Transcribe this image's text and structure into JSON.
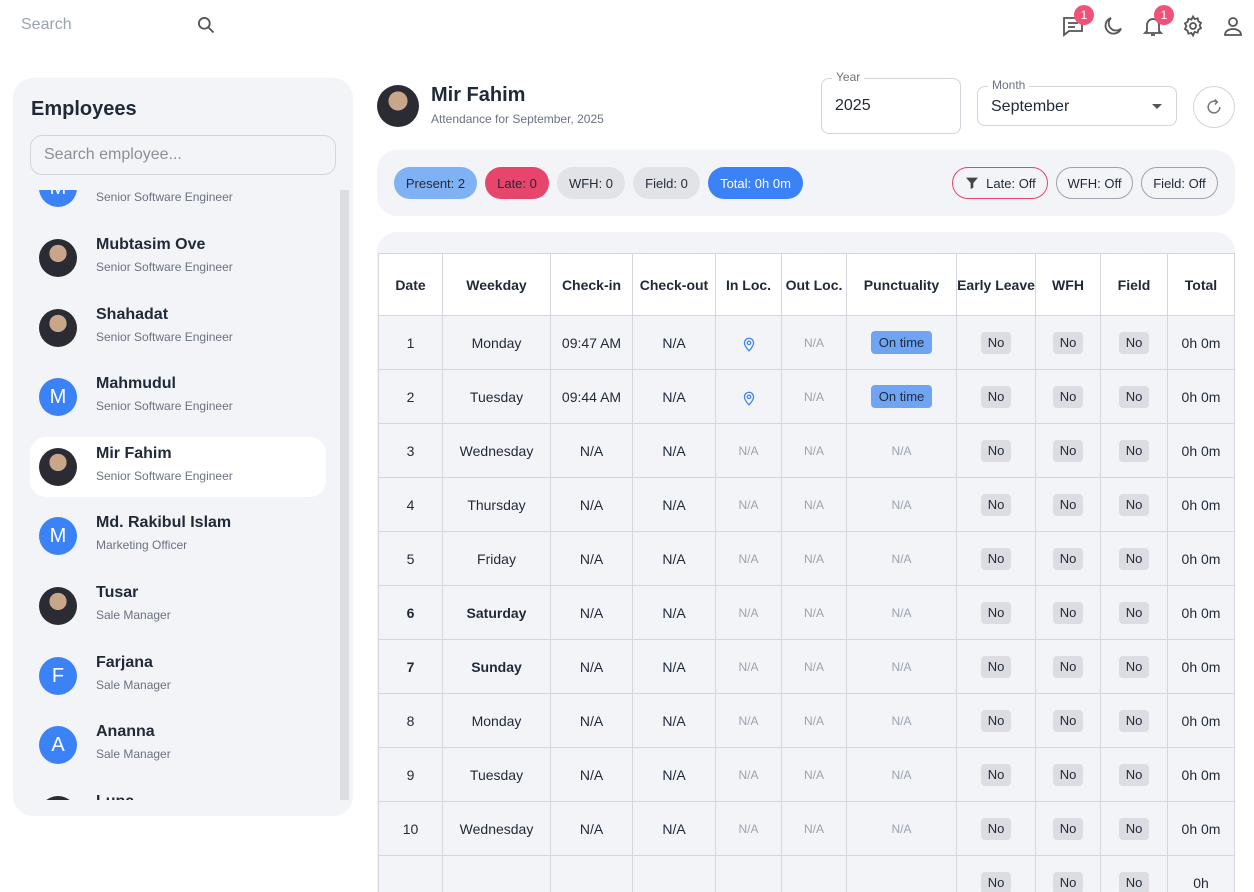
{
  "topbar": {
    "search_placeholder": "Search",
    "messages_badge": "1",
    "notifications_badge": "1"
  },
  "sidebar": {
    "title": "Employees",
    "search_placeholder": "Search employee...",
    "employees": [
      {
        "name": "",
        "role": "Senior Software Engineer",
        "avatar": "M",
        "avatar_type": "letter"
      },
      {
        "name": "Mubtasim Ove",
        "role": "Senior Software Engineer",
        "avatar": "",
        "avatar_type": "photo"
      },
      {
        "name": "Shahadat",
        "role": "Senior Software Engineer",
        "avatar": "",
        "avatar_type": "photo"
      },
      {
        "name": "Mahmudul",
        "role": "Senior Software Engineer",
        "avatar": "M",
        "avatar_type": "letter"
      },
      {
        "name": "Mir Fahim",
        "role": "Senior Software Engineer",
        "avatar": "",
        "avatar_type": "photo",
        "selected": true
      },
      {
        "name": "Md. Rakibul Islam",
        "role": "Marketing Officer",
        "avatar": "M",
        "avatar_type": "letter"
      },
      {
        "name": "Tusar",
        "role": "Sale Manager",
        "avatar": "",
        "avatar_type": "photo"
      },
      {
        "name": "Farjana",
        "role": "Sale Manager",
        "avatar": "F",
        "avatar_type": "letter"
      },
      {
        "name": "Ananna",
        "role": "Sale Manager",
        "avatar": "A",
        "avatar_type": "letter"
      },
      {
        "name": "Lupa",
        "role": "",
        "avatar": "",
        "avatar_type": "photo"
      }
    ]
  },
  "header": {
    "name": "Mir Fahim",
    "subtitle": "Attendance for September, 2025",
    "year_label": "Year",
    "year_value": "2025",
    "month_label": "Month",
    "month_value": "September"
  },
  "summary": {
    "present": "Present: 2",
    "late": "Late: 0",
    "wfh": "WFH: 0",
    "field": "Field: 0",
    "total": "Total: 0h 0m",
    "filter_late": "Late: Off",
    "filter_wfh": "WFH: Off",
    "filter_field": "Field: Off"
  },
  "table": {
    "columns": [
      "Date",
      "Weekday",
      "Check-in",
      "Check-out",
      "In Loc.",
      "Out Loc.",
      "Punctuality",
      "Early Leave",
      "WFH",
      "Field",
      "Total"
    ],
    "rows": [
      {
        "date": "1",
        "weekday": "Monday",
        "checkin": "09:47 AM",
        "checkout": "N/A",
        "inloc": "pin",
        "outloc": "N/A",
        "punctuality": "On time",
        "early": "No",
        "wfh": "No",
        "field": "No",
        "total": "0h 0m",
        "weekend": false
      },
      {
        "date": "2",
        "weekday": "Tuesday",
        "checkin": "09:44 AM",
        "checkout": "N/A",
        "inloc": "pin",
        "outloc": "N/A",
        "punctuality": "On time",
        "early": "No",
        "wfh": "No",
        "field": "No",
        "total": "0h 0m",
        "weekend": false
      },
      {
        "date": "3",
        "weekday": "Wednesday",
        "checkin": "N/A",
        "checkout": "N/A",
        "inloc": "N/A",
        "outloc": "N/A",
        "punctuality": "N/A",
        "early": "No",
        "wfh": "No",
        "field": "No",
        "total": "0h 0m",
        "weekend": false
      },
      {
        "date": "4",
        "weekday": "Thursday",
        "checkin": "N/A",
        "checkout": "N/A",
        "inloc": "N/A",
        "outloc": "N/A",
        "punctuality": "N/A",
        "early": "No",
        "wfh": "No",
        "field": "No",
        "total": "0h 0m",
        "weekend": false
      },
      {
        "date": "5",
        "weekday": "Friday",
        "checkin": "N/A",
        "checkout": "N/A",
        "inloc": "N/A",
        "outloc": "N/A",
        "punctuality": "N/A",
        "early": "No",
        "wfh": "No",
        "field": "No",
        "total": "0h 0m",
        "weekend": false
      },
      {
        "date": "6",
        "weekday": "Saturday",
        "checkin": "N/A",
        "checkout": "N/A",
        "inloc": "N/A",
        "outloc": "N/A",
        "punctuality": "N/A",
        "early": "No",
        "wfh": "No",
        "field": "No",
        "total": "0h 0m",
        "weekend": true
      },
      {
        "date": "7",
        "weekday": "Sunday",
        "checkin": "N/A",
        "checkout": "N/A",
        "inloc": "N/A",
        "outloc": "N/A",
        "punctuality": "N/A",
        "early": "No",
        "wfh": "No",
        "field": "No",
        "total": "0h 0m",
        "weekend": true
      },
      {
        "date": "8",
        "weekday": "Monday",
        "checkin": "N/A",
        "checkout": "N/A",
        "inloc": "N/A",
        "outloc": "N/A",
        "punctuality": "N/A",
        "early": "No",
        "wfh": "No",
        "field": "No",
        "total": "0h 0m",
        "weekend": false
      },
      {
        "date": "9",
        "weekday": "Tuesday",
        "checkin": "N/A",
        "checkout": "N/A",
        "inloc": "N/A",
        "outloc": "N/A",
        "punctuality": "N/A",
        "early": "No",
        "wfh": "No",
        "field": "No",
        "total": "0h 0m",
        "weekend": false
      },
      {
        "date": "10",
        "weekday": "Wednesday",
        "checkin": "N/A",
        "checkout": "N/A",
        "inloc": "N/A",
        "outloc": "N/A",
        "punctuality": "N/A",
        "early": "No",
        "wfh": "No",
        "field": "No",
        "total": "0h 0m",
        "weekend": false
      },
      {
        "date": "",
        "weekday": "",
        "checkin": "",
        "checkout": "",
        "inloc": "",
        "outloc": "",
        "punctuality": "",
        "early": "No",
        "wfh": "No",
        "field": "No",
        "total": "0h",
        "weekend": false
      }
    ]
  },
  "colors": {
    "accent": "#3b82f6",
    "late": "#e8456d",
    "badge": "#f0527a"
  }
}
